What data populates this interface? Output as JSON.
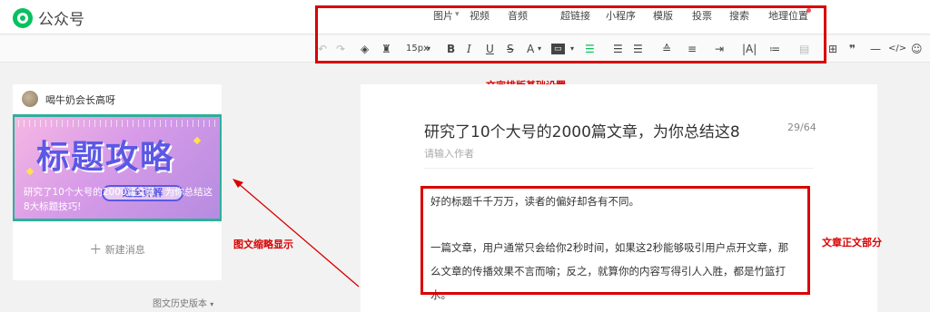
{
  "app": {
    "name": "公众号"
  },
  "insert_tools": [
    "图片",
    "视频",
    "音频",
    "超链接",
    "小程序",
    "模版",
    "投票",
    "搜索",
    "地理位置"
  ],
  "format": {
    "font_size": "15px",
    "bold": "B",
    "italic": "I",
    "underline": "U",
    "strike": "S",
    "font_color": "A",
    "quote": "❞",
    "divider": "—",
    "code": "</>"
  },
  "annotations": {
    "toolbar": "文字排版基础设置",
    "thumbnail": "图文缩略显示",
    "body": "文章正文部分"
  },
  "left": {
    "account": "喝牛奶会长高呀",
    "cover_title": "标题攻略",
    "cover_badge": "超全详解",
    "cover_caption_line1": "研究了10个大号的2000篇文章，为你总结这",
    "cover_caption_line2": "8大标题技巧!",
    "new_message": "新建消息",
    "history": "图文历史版本"
  },
  "editor": {
    "title": "研究了10个大号的2000篇文章，为你总结这8",
    "title_count": "29/64",
    "author_placeholder": "请输入作者",
    "para1": "好的标题千千万万，读者的偏好却各有不同。",
    "para2_line1": "一篇文章，用户通常只会给你2秒时间，如果这2秒能够吸引用户点开文章，那",
    "para2_line2": "么文章的传播效果不言而喻；反之，就算你的内容写得引人入胜，都是竹篮打",
    "para2_line3": "水。"
  },
  "colors": {
    "accent": "#07c160",
    "annotation_red": "#d90000",
    "cover_purple": "#5b58e6"
  }
}
